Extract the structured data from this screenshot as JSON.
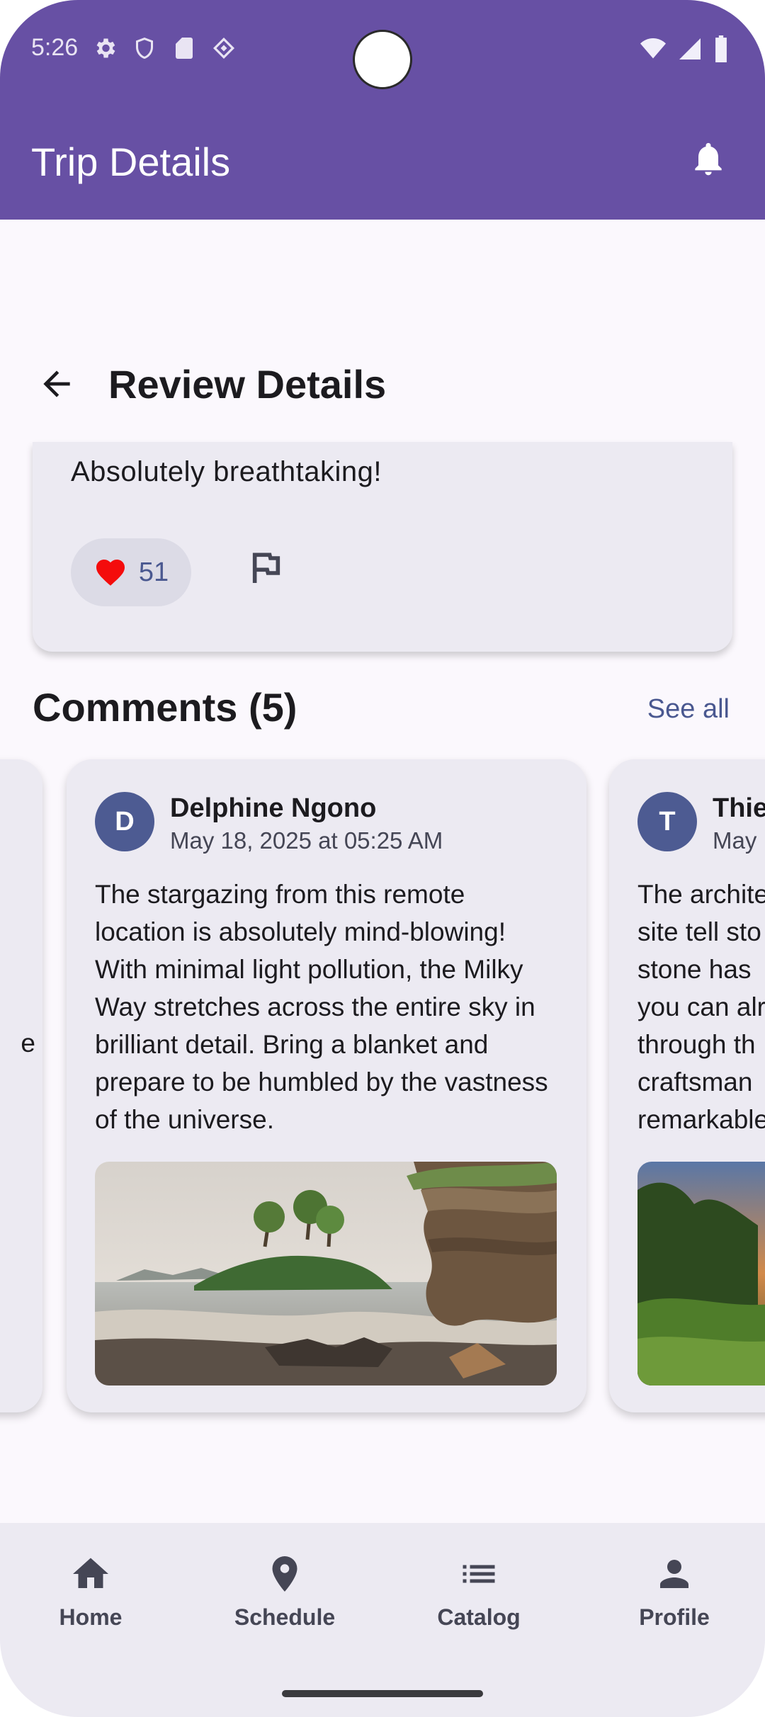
{
  "status_bar": {
    "time": "5:26",
    "left_icons": [
      "settings-icon",
      "shield-icon",
      "sd-card-icon",
      "vpn-icon"
    ],
    "right_icons": [
      "wifi-icon",
      "signal-icon",
      "battery-icon"
    ]
  },
  "app_bar": {
    "title": "Trip Details",
    "action_icon": "bell-icon"
  },
  "sub_header": {
    "back_icon": "arrow-back-icon",
    "title": "Review Details"
  },
  "review": {
    "text": "Absolutely breathtaking!",
    "likes": "51",
    "like_icon": "heart-icon",
    "report_icon": "flag-icon"
  },
  "comments": {
    "title": "Comments (5)",
    "see_all": "See all",
    "left_partial_char": "e",
    "items": [
      {
        "initial": "D",
        "author": "Delphine Ngono",
        "date": "May 18, 2025 at 05:25 AM",
        "text": "The stargazing from this remote location is absolutely mind-blowing! With minimal light pollution, the Milky Way stretches across the entire sky in brilliant detail. Bring a blanket and prepare to be humbled by the vastness of the universe."
      },
      {
        "initial": "T",
        "author": "Thie",
        "date": "May",
        "text": "The archite\nsite tell sto\nstone has \nyou can alr\nthrough th\ncraftsman\nremarkable"
      }
    ]
  },
  "bottom_nav": {
    "items": [
      {
        "label": "Home",
        "icon": "home-icon"
      },
      {
        "label": "Schedule",
        "icon": "location-pin-icon"
      },
      {
        "label": "Catalog",
        "icon": "list-icon"
      },
      {
        "label": "Profile",
        "icon": "person-icon"
      }
    ]
  },
  "colors": {
    "primary": "#6750a4",
    "surface": "#fbf8fd",
    "card": "#eceaf2",
    "accent_text": "#4a5890",
    "like": "#f40c0c"
  }
}
